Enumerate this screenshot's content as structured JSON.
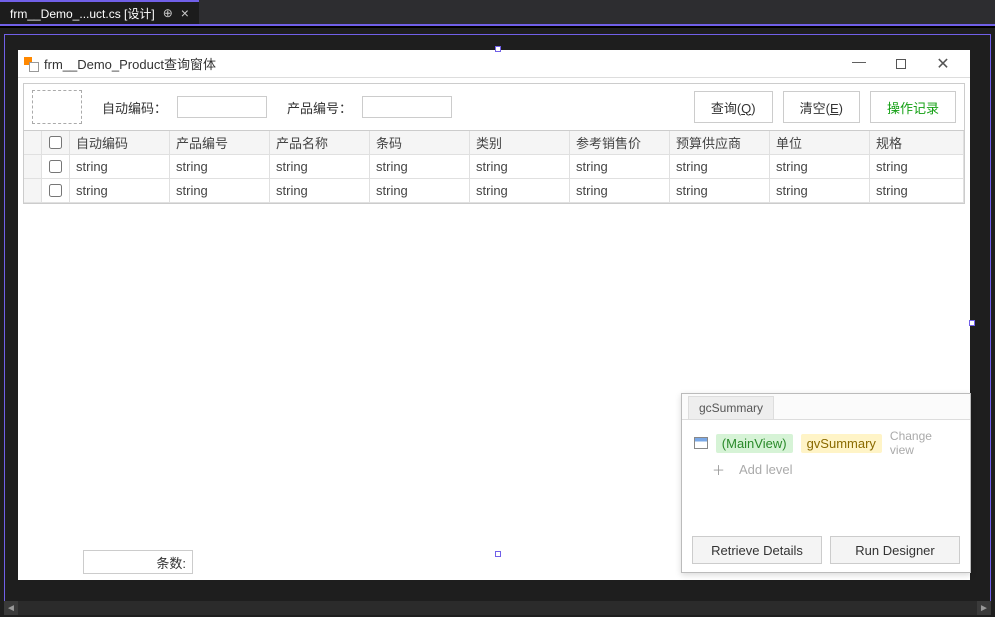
{
  "ide_tab": {
    "title": "frm__Demo_...uct.cs [设计]"
  },
  "window": {
    "title": "frm__Demo_Product查询窗体"
  },
  "filters": {
    "label_auto_code": "自动编码：",
    "value_auto_code": "",
    "label_product_no": "产品编号：",
    "value_product_no": ""
  },
  "buttons": {
    "query_prefix": "查询(",
    "query_mnemonic": "Q",
    "query_suffix": ")",
    "clear_prefix": "清空(",
    "clear_mnemonic": "E",
    "clear_suffix": ")",
    "oplog": "操作记录"
  },
  "grid": {
    "columns": [
      "自动编码",
      "产品编号",
      "产品名称",
      "条码",
      "类别",
      "参考销售价",
      "预算供应商",
      "单位",
      "规格"
    ],
    "rows": [
      [
        "string",
        "string",
        "string",
        "string",
        "string",
        "string",
        "string",
        "string",
        "string"
      ],
      [
        "string",
        "string",
        "string",
        "string",
        "string",
        "string",
        "string",
        "string",
        "string"
      ]
    ]
  },
  "footer": {
    "count_label": "条数:"
  },
  "designer_popup": {
    "tab": "gcSummary",
    "mainview": "(MainView)",
    "gvsummary": "gvSummary",
    "change_view": "Change view",
    "add_level": "Add level",
    "retrieve_details": "Retrieve Details",
    "run_designer": "Run Designer"
  }
}
